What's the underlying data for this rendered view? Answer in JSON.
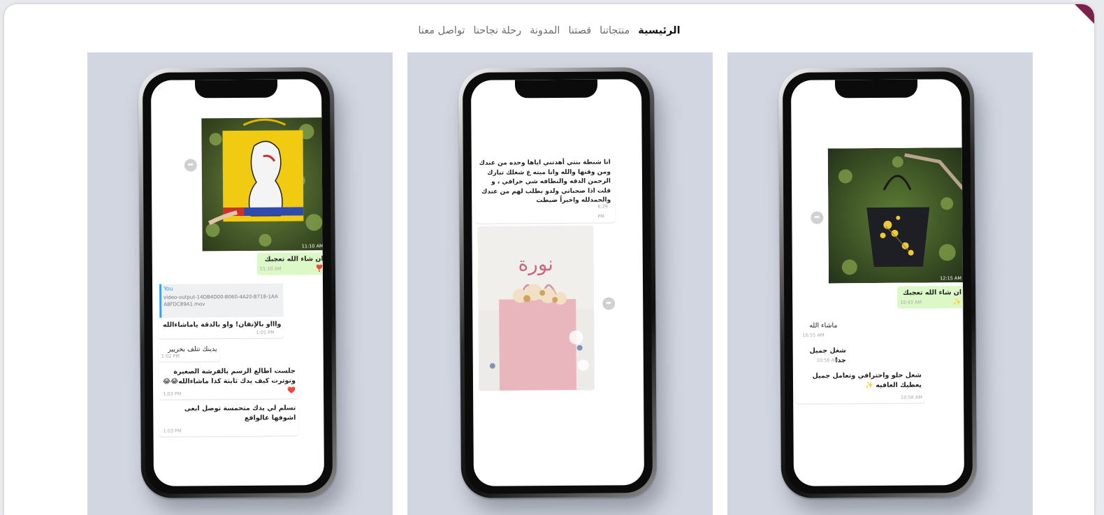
{
  "nav": {
    "items": [
      "الرئيسية",
      "منتجاتنا",
      "قصتنا",
      "المدونة",
      "رحلة نجاحنا",
      "تواصل معنا"
    ],
    "active_index": 0
  },
  "phones": {
    "right": {
      "photo_timestamp": "12:15 AM",
      "caption": "ان شاء الله تعجبك ✨",
      "caption_time": "10:43 AM",
      "msg1": "ماشاء الله",
      "msg1_time": "10:55 AM",
      "msg2": "شغل جميل جدا",
      "msg2_time": "10:56 AM",
      "msg3": "شغل حلو واحترافي وتعامل جميل يعطيك العافيه ✨",
      "msg3_time": "10:56 AM"
    },
    "middle": {
      "text": "انا شنطة بنتي أهدتني اياها وحده من عندك ومن وقتها والله وانا ميته ع شغلك تبارك الرحمن الدقه والنظافه شي خرافي ، و قلت اذا صحباتي ولدو بطلب لهم من عندك والحمدلله واخيراً ضبطت",
      "text_time": "6:29 PM",
      "box_brand": "نورة"
    },
    "left": {
      "photo_timestamp": "11:10 AM",
      "caption": "ان شاء الله تعجبك ❣️",
      "caption_time": "11:10 AM",
      "reply_sender": "You",
      "reply_file": "video-output-14DB4D00-B060-4A20-B718-1AAA8FDC89A1.mov",
      "reply_text": "واااو بالإتقان! واو بالدقة ياماشاءالله",
      "reply_time": "1:01 PM",
      "msg1": "يدينك تتلف بحريير",
      "msg1_time": "1:02 PM",
      "msg2": "جلست اطالع الرسم بالفرشة الصغيرة وتوترت كيف يدك ثابتة كذا ماشاءالله😂😂❤️",
      "msg2_time": "1:03 PM",
      "msg3": "تسلم لي يدك متحمسة توصل ابغى اشوفها عالواقع",
      "msg3_time": "1:03 PM"
    }
  },
  "colors": {
    "panel_bg": "#d2d6e0",
    "outgoing_bubble": "#dcf8c6",
    "accent_corner": "#7a2149",
    "reply_bar": "#3aa0f0"
  },
  "icons": {
    "share": "share-arrow-icon"
  }
}
